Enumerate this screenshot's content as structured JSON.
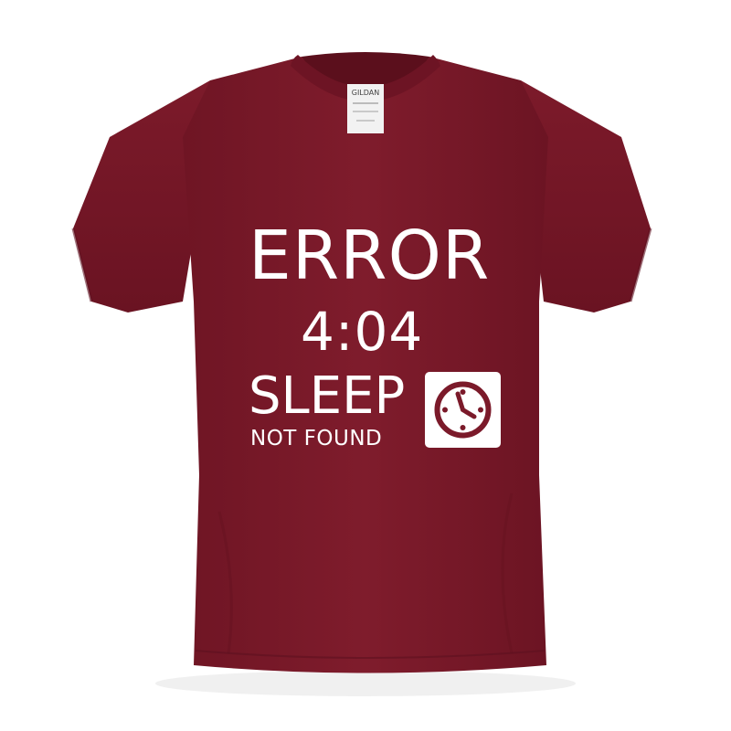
{
  "product": {
    "garment": "t-shirt",
    "shirt_color": "#7b1a2a",
    "print_color": "#ffffff"
  },
  "print": {
    "line1": "ERROR",
    "line2": "4:04",
    "line3": "SLEEP",
    "line4": "NOT FOUND",
    "icon": "clock-icon"
  },
  "neck_label": {
    "brand": "GILDAN"
  }
}
